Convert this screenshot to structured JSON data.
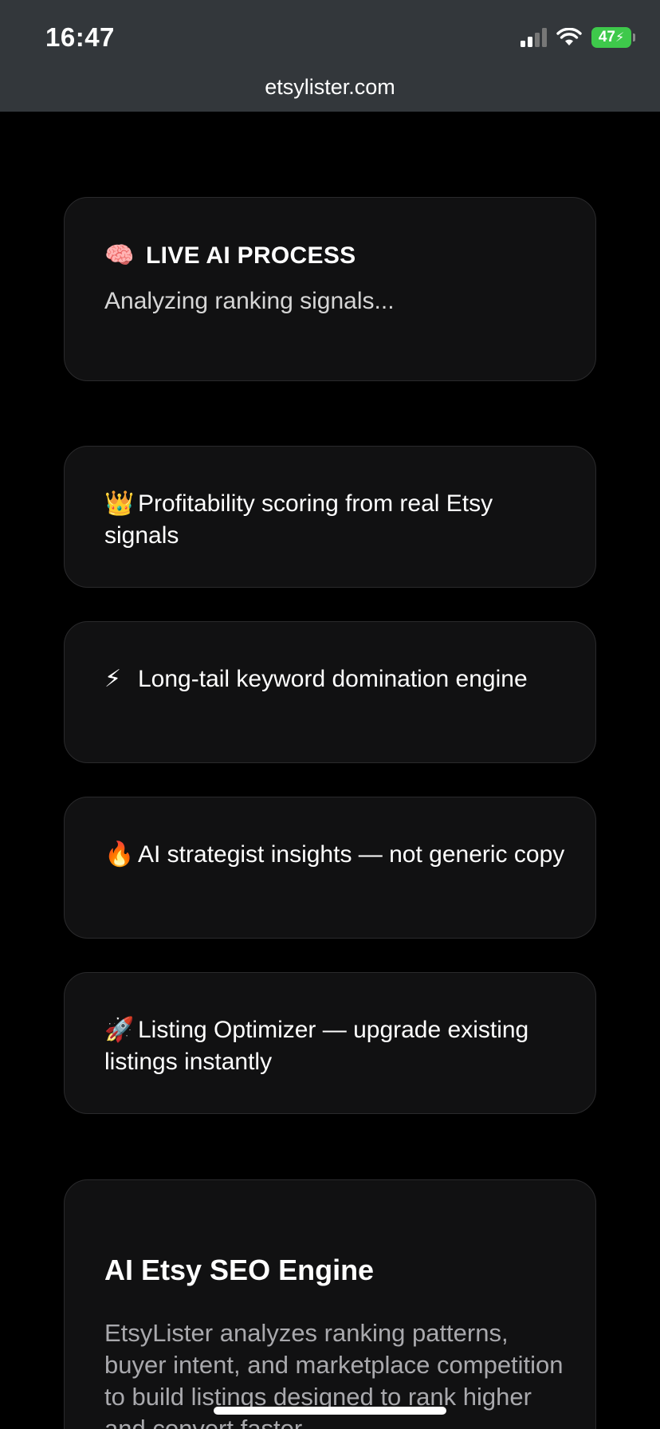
{
  "status_bar": {
    "time": "16:47",
    "battery": "47",
    "battery_color": "#3ec94b"
  },
  "browser": {
    "url": "etsylister.com"
  },
  "peek_text": "",
  "live_card": {
    "icon": "brain-icon",
    "emoji": "🧠",
    "title": "LIVE AI PROCESS",
    "status": "Analyzing ranking signals..."
  },
  "features": [
    {
      "icon": "crown-icon",
      "emoji": "👑",
      "text": "Profitability scoring from real Etsy signals"
    },
    {
      "icon": "lightning-icon",
      "emoji": "⚡",
      "text": "Long-tail keyword domination engine"
    },
    {
      "icon": "fire-icon",
      "emoji": "🔥",
      "text": "AI strategist insights — not generic copy"
    },
    {
      "icon": "rocket-icon",
      "emoji": "🚀",
      "text": "Listing Optimizer — upgrade existing listings instantly"
    }
  ],
  "seo_card": {
    "title": "AI Etsy SEO Engine",
    "body": "EtsyLister analyzes ranking patterns, buyer intent, and marketplace competition to build listings designed to rank higher and convert faster."
  }
}
